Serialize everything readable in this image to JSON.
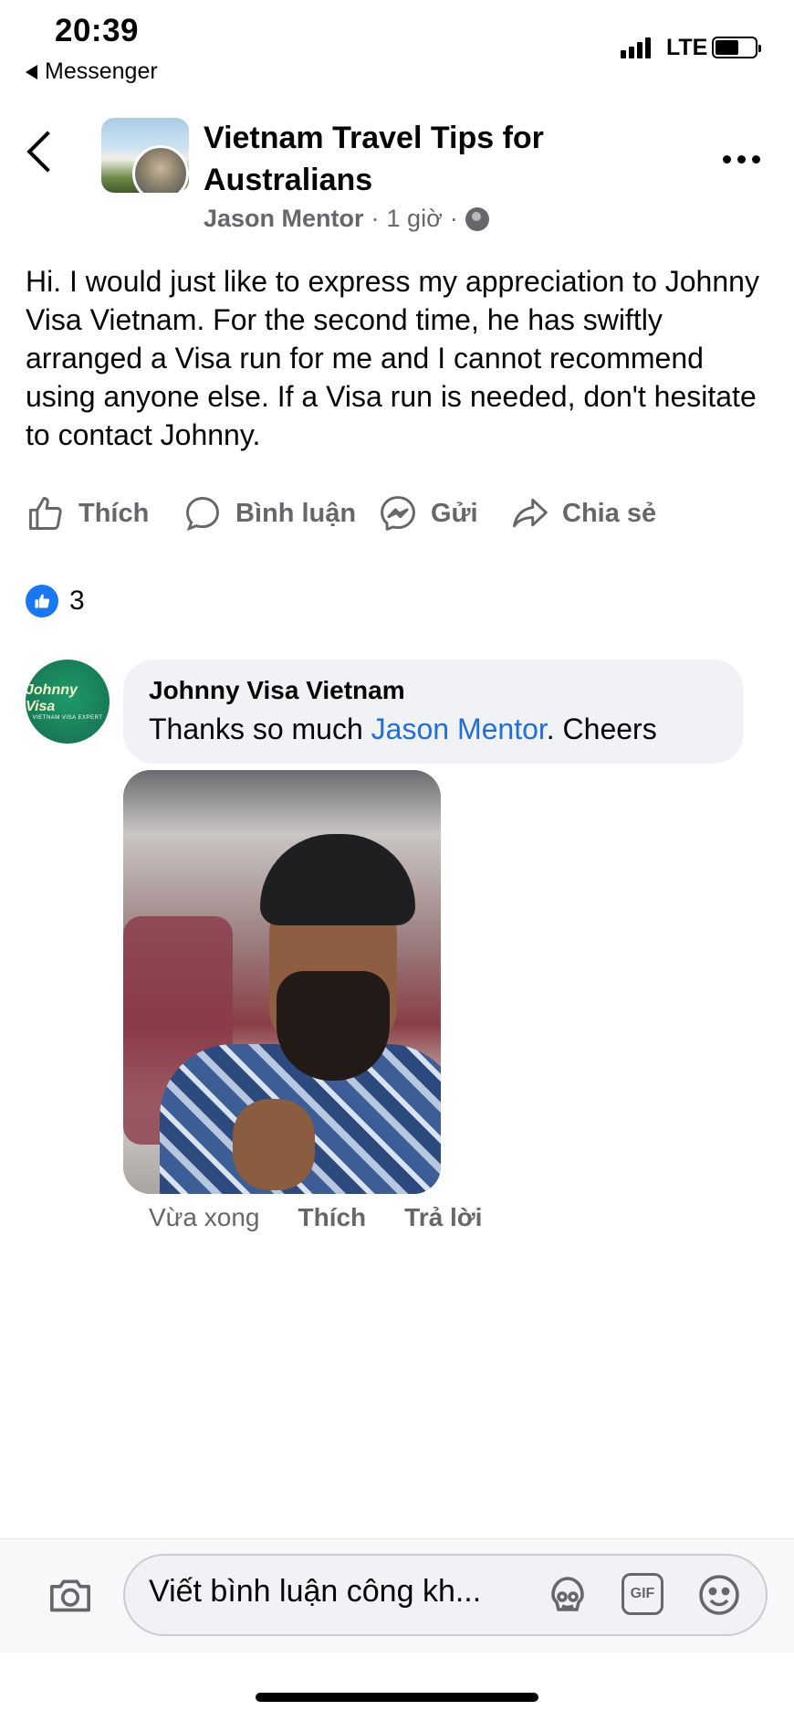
{
  "status_bar": {
    "time": "20:39",
    "back_app": "Messenger",
    "network": "LTE"
  },
  "header": {
    "title": "Vietnam Travel Tips for Australians",
    "author": "Jason Mentor",
    "separator": "·",
    "time_ago": "1 giờ",
    "privacy_icon": "globe-icon"
  },
  "post": {
    "text": "Hi. I would just like to express my appreciation to Johnny Visa Vietnam. For the second time, he has swiftly arranged a Visa run for me and I cannot recommend using anyone else. If a Visa run is needed, don't hesitate to contact Johnny."
  },
  "actions": {
    "like": "Thích",
    "comment": "Bình luận",
    "send": "Gửi",
    "share": "Chia sẻ"
  },
  "reactions": {
    "count": "3"
  },
  "comment": {
    "avatar_text": "Johnny Visa",
    "avatar_subtext": "VIETNAM VISA EXPERT",
    "author": "Johnny Visa Vietnam",
    "text_before": "Thanks so much ",
    "mention": "Jason Mentor",
    "text_after": ". Cheers",
    "time": "Vừa xong",
    "like": "Thích",
    "reply": "Trả lời"
  },
  "composer": {
    "placeholder": "Viết bình luận công kh...",
    "gif_label": "GIF"
  },
  "colors": {
    "accent": "#1877f2",
    "mention": "#216fdb",
    "muted": "#65676b"
  }
}
